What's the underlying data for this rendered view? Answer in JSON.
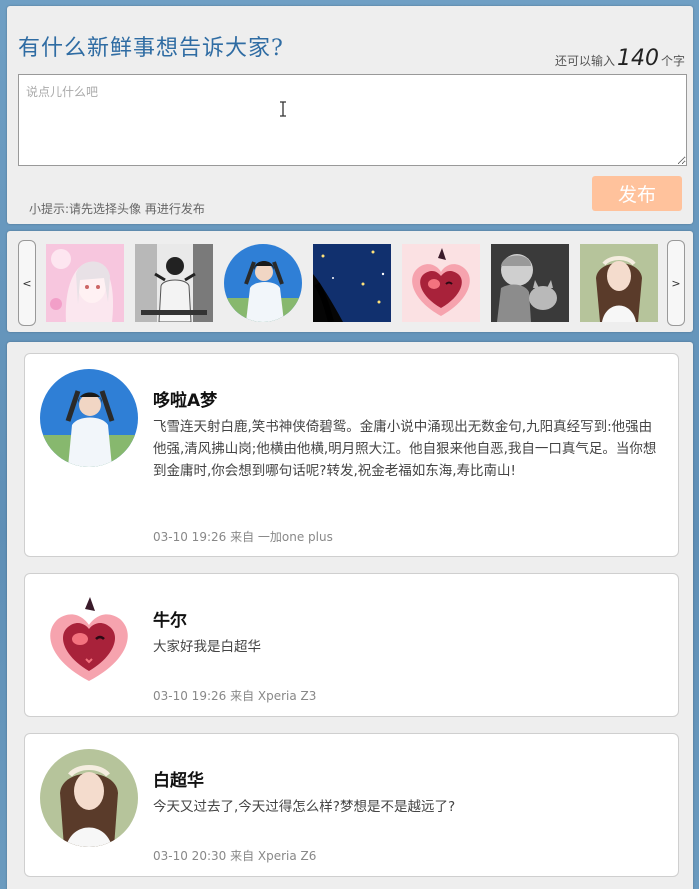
{
  "compose": {
    "title": "有什么新鲜事想告诉大家?",
    "counter_prefix": "还可以输入",
    "counter_value": "140",
    "counter_suffix": "个字",
    "placeholder": "说点儿什么吧",
    "hint": "小提示:请先选择头像 再进行发布",
    "publish_label": "发布"
  },
  "picker": {
    "prev_label": "<",
    "next_label": ">",
    "avatars": [
      "anime-pink-girl",
      "monochrome-person",
      "girl-blue-sky",
      "dark-hair-stars",
      "red-cartoon-heart",
      "child-with-kitten",
      "girl-flower-crown"
    ]
  },
  "posts": [
    {
      "name": "哆啦A梦",
      "content": "飞雪连天射白鹿,笑书神侠倚碧鸳。金庸小说中涌现出无数金句,九阳真经写到:他强由他强,清风拂山岗;他横由他横,明月照大江。他自狠来他自恶,我自一口真气足。当你想到金庸时,你会想到哪句话呢?转发,祝金老福如东海,寿比南山!",
      "meta": "03-10 19:26 来自 一加one plus",
      "avatar": "girl-blue-sky"
    },
    {
      "name": "牛尔",
      "content": "大家好我是白超华",
      "meta": "03-10 19:26 来自 Xperia Z3",
      "avatar": "red-cartoon-heart"
    },
    {
      "name": "白超华",
      "content": "今天又过去了,今天过得怎么样?梦想是不是越远了?",
      "meta": "03-10 20:30 来自 Xperia Z6",
      "avatar": "girl-flower-crown"
    }
  ],
  "colors": {
    "accent": "#2f6ca3",
    "publish_button": "#ffc29c",
    "background": "#6f9fc4"
  }
}
